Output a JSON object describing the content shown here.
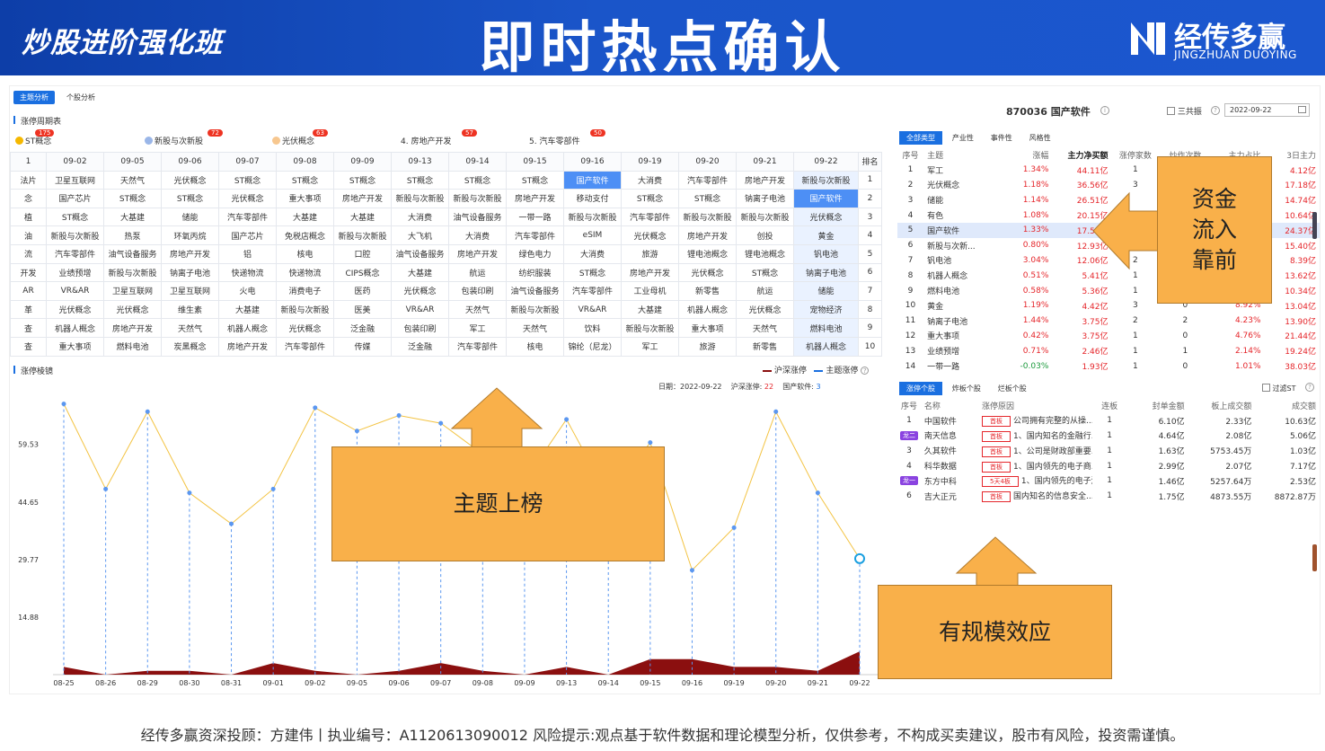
{
  "banner": {
    "course": "炒股进阶强化班",
    "title": "即时热点确认",
    "brand_cn": "经传多赢",
    "brand_en": "JINGZHUAN DUOYING"
  },
  "footer": "经传多赢资深投顾：方建伟丨执业编号：A1120613090012   风险提示:观点基于软件数据和理论模型分析，仅供参考，不构成买卖建议，股市有风险，投资需谨慎。",
  "tabs": [
    "主题分析",
    "个股分析"
  ],
  "section1": "涨停周期表",
  "section2": "涨停棱镜",
  "categories": [
    {
      "label": "ST概念",
      "badge": "175",
      "color": "#f5b800"
    },
    {
      "label": "新股与次新股",
      "badge": "72",
      "color": "#9ab6e8"
    },
    {
      "label": "光伏概念",
      "badge": "63",
      "color": "#f7c78f"
    },
    {
      "label": "4. 房地产开发",
      "badge": "57",
      "color": ""
    },
    {
      "label": "5. 汽车零部件",
      "badge": "50",
      "color": ""
    }
  ],
  "grid": {
    "dates": [
      "1",
      "09-02",
      "09-05",
      "09-06",
      "09-07",
      "09-08",
      "09-09",
      "09-13",
      "09-14",
      "09-15",
      "09-16",
      "09-19",
      "09-20",
      "09-21",
      "09-22"
    ],
    "rank_header": "排名",
    "rows": [
      [
        "法片",
        "卫星互联网",
        "天然气",
        "光伏概念",
        "ST概念",
        "ST概念",
        "ST概念",
        "ST概念",
        "ST概念",
        "ST概念",
        "国产软件",
        "大消费",
        "汽车零部件",
        "房地产开发",
        "新股与次新股",
        "1"
      ],
      [
        "念",
        "国产芯片",
        "ST概念",
        "ST概念",
        "光伏概念",
        "重大事项",
        "房地产开发",
        "新股与次新股",
        "新股与次新股",
        "房地产开发",
        "移动支付",
        "ST概念",
        "ST概念",
        "钠离子电池",
        "国产软件",
        "2"
      ],
      [
        "植",
        "ST概念",
        "大基建",
        "储能",
        "汽车零部件",
        "大基建",
        "大基建",
        "大消费",
        "油气设备服务",
        "一带一路",
        "新股与次新股",
        "汽车零部件",
        "新股与次新股",
        "新股与次新股",
        "光伏概念",
        "3"
      ],
      [
        "油",
        "新股与次新股",
        "热泵",
        "环氧丙烷",
        "国产芯片",
        "免税店概念",
        "新股与次新股",
        "大飞机",
        "大消费",
        "汽车零部件",
        "eSIM",
        "光伏概念",
        "房地产开发",
        "创投",
        "黄金",
        "4"
      ],
      [
        "流",
        "汽车零部件",
        "油气设备服务",
        "房地产开发",
        "铝",
        "核电",
        "口腔",
        "油气设备服务",
        "房地产开发",
        "绿色电力",
        "大消费",
        "旅游",
        "锂电池概念",
        "锂电池概念",
        "钒电池",
        "5"
      ],
      [
        "开发",
        "业绩预增",
        "新股与次新股",
        "钠离子电池",
        "快递物流",
        "快递物流",
        "CIPS概念",
        "大基建",
        "航运",
        "纺织服装",
        "ST概念",
        "房地产开发",
        "光伏概念",
        "ST概念",
        "钠离子电池",
        "6"
      ],
      [
        "AR",
        "VR&AR",
        "卫星互联网",
        "卫星互联网",
        "火电",
        "消费电子",
        "医药",
        "光伏概念",
        "包装印刷",
        "油气设备服务",
        "汽车零部件",
        "工业母机",
        "新零售",
        "航运",
        "储能",
        "7"
      ],
      [
        "革",
        "光伏概念",
        "光伏概念",
        "维生素",
        "大基建",
        "新股与次新股",
        "医美",
        "VR&AR",
        "天然气",
        "新股与次新股",
        "VR&AR",
        "大基建",
        "机器人概念",
        "光伏概念",
        "宠物经济",
        "8"
      ],
      [
        "查",
        "机器人概念",
        "房地产开发",
        "天然气",
        "机器人概念",
        "光伏概念",
        "泛金融",
        "包装印刷",
        "军工",
        "天然气",
        "饮料",
        "新股与次新股",
        "重大事项",
        "天然气",
        "燃料电池",
        "9"
      ],
      [
        "查",
        "重大事项",
        "燃料电池",
        "炭黑概念",
        "房地产开发",
        "汽车零部件",
        "传媒",
        "泛金融",
        "汽车零部件",
        "核电",
        "锦纶（尼龙）",
        "军工",
        "旅游",
        "新零售",
        "机器人概念",
        "10"
      ]
    ]
  },
  "chart": {
    "legend": [
      "沪深涨停",
      "主题涨停"
    ],
    "info": {
      "date_label": "日期：",
      "date": "2022-09-22",
      "hs_label": "沪深涨停:",
      "hs": "22",
      "theme_label": "国产软件:",
      "theme": "3"
    }
  },
  "chart_data": {
    "type": "line",
    "x": [
      "08-25",
      "08-26",
      "08-29",
      "08-30",
      "08-31",
      "09-01",
      "09-02",
      "09-05",
      "09-06",
      "09-07",
      "09-08",
      "09-09",
      "09-13",
      "09-14",
      "09-15",
      "09-16",
      "09-19",
      "09-20",
      "09-21",
      "09-22"
    ],
    "yticks": [
      "59.53",
      "44.65",
      "29.77",
      "14.88"
    ],
    "ylim": [
      0,
      72
    ],
    "series": [
      {
        "name": "沪深涨停",
        "values": [
          70,
          48,
          68,
          47,
          39,
          48,
          69,
          63,
          67,
          65,
          57,
          50,
          66,
          46,
          60,
          27,
          38,
          68,
          47,
          30
        ]
      },
      {
        "name": "主题涨停",
        "values": [
          2,
          0,
          1,
          1,
          0,
          3,
          1,
          0,
          1,
          3,
          1,
          0,
          2,
          0,
          4,
          4,
          2,
          2,
          1,
          6
        ]
      }
    ]
  },
  "right": {
    "stock_title": "870036 国产软件",
    "checkbox_label": "三共振",
    "date": "2022-09-22",
    "tabs": [
      "全部类型",
      "产业性",
      "事件性",
      "风格性"
    ],
    "headers": [
      "序号",
      "主题",
      "涨幅",
      "主力净买额",
      "涨停家数",
      "炒作次数",
      "主力占比",
      "3日主力"
    ],
    "rows": [
      [
        "1",
        "军工",
        "1.34%",
        "44.11亿",
        "1",
        "",
        "",
        "4.12亿"
      ],
      [
        "2",
        "光伏概念",
        "1.18%",
        "36.56亿",
        "3",
        "",
        "",
        "17.18亿"
      ],
      [
        "3",
        "储能",
        "1.14%",
        "26.51亿",
        "",
        "",
        "",
        "14.74亿"
      ],
      [
        "4",
        "有色",
        "1.08%",
        "20.15亿",
        "",
        "",
        "",
        "10.64亿"
      ],
      [
        "5",
        "国产软件",
        "1.33%",
        "17.50亿",
        "",
        "",
        "",
        "24.37亿"
      ],
      [
        "6",
        "新股与次新...",
        "0.80%",
        "12.93亿",
        "",
        "",
        "",
        "15.40亿"
      ],
      [
        "7",
        "钒电池",
        "3.04%",
        "12.06亿",
        "2",
        "",
        "",
        "8.39亿"
      ],
      [
        "8",
        "机器人概念",
        "0.51%",
        "5.41亿",
        "1",
        "",
        "",
        "13.62亿"
      ],
      [
        "9",
        "燃料电池",
        "0.58%",
        "5.36亿",
        "1",
        "",
        "",
        "10.34亿"
      ],
      [
        "10",
        "黄金",
        "1.19%",
        "4.42亿",
        "3",
        "0",
        "8.92%",
        "13.04亿"
      ],
      [
        "11",
        "钠离子电池",
        "1.44%",
        "3.75亿",
        "2",
        "2",
        "4.23%",
        "13.90亿"
      ],
      [
        "12",
        "重大事项",
        "0.42%",
        "3.75亿",
        "1",
        "0",
        "4.76%",
        "21.44亿"
      ],
      [
        "13",
        "业绩预增",
        "0.71%",
        "2.46亿",
        "1",
        "1",
        "2.14%",
        "19.24亿"
      ],
      [
        "14",
        "一带一路",
        "-0.03%",
        "1.93亿",
        "1",
        "0",
        "1.01%",
        "38.03亿"
      ]
    ],
    "tabs2": [
      "涨停个股",
      "炸板个股",
      "烂板个股"
    ],
    "filter_label": "过滤ST",
    "headers2": [
      "序号",
      "名称",
      "涨停原因",
      "连板",
      "封单金额",
      "板上成交额",
      "成交额"
    ],
    "rows2": [
      [
        "1",
        "中国软件",
        "首板",
        "公司拥有完整的从操...",
        "1",
        "6.10亿",
        "2.33亿",
        "10.63亿",
        ""
      ],
      [
        "2",
        "南天信息",
        "首板",
        "1、国内知名的金融行...",
        "1",
        "4.64亿",
        "2.08亿",
        "5.06亿",
        "龙二"
      ],
      [
        "3",
        "久其软件",
        "首板",
        "1、公司是财政部重要...",
        "1",
        "1.63亿",
        "5753.45万",
        "1.03亿",
        ""
      ],
      [
        "4",
        "科华数据",
        "首板",
        "1、国内领先的电子商...",
        "1",
        "2.99亿",
        "2.07亿",
        "7.17亿",
        ""
      ],
      [
        "5",
        "东方中科",
        "5天4板",
        "1、国内领先的电子测...",
        "1",
        "1.46亿",
        "5257.64万",
        "2.53亿",
        "龙一"
      ],
      [
        "6",
        "吉大正元",
        "首板",
        "国内知名的信息安全...",
        "1",
        "1.75亿",
        "4873.55万",
        "8872.87万",
        ""
      ]
    ]
  },
  "callouts": {
    "funds": "资金流入靠前",
    "topic": "主题上榜",
    "scale": "有规模效应"
  }
}
